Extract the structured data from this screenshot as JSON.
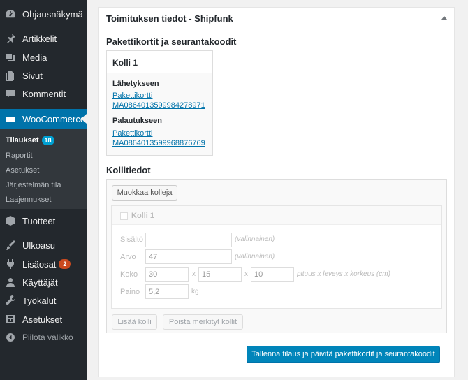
{
  "sidebar": {
    "dashboard": "Ohjausnäkymä",
    "posts": "Artikkelit",
    "media": "Media",
    "pages": "Sivut",
    "comments": "Kommentit",
    "woocommerce": "WooCommerce",
    "submenu": {
      "orders": "Tilaukset",
      "orders_badge": "18",
      "reports": "Raportit",
      "settings": "Asetukset",
      "status": "Järjestelmän tila",
      "extensions": "Laajennukset"
    },
    "products": "Tuotteet",
    "appearance": "Ulkoasu",
    "plugins": "Lisäosat",
    "plugins_badge": "2",
    "users": "Käyttäjät",
    "tools": "Työkalut",
    "settings": "Asetukset",
    "collapse": "Piilota valikko"
  },
  "panel": {
    "title": "Toimituksen tiedot - Shipfunk",
    "labels_title": "Pakettikortit ja seurantakoodit",
    "package": {
      "title": "Kolli 1",
      "outbound_title": "Lähetykseen",
      "outbound_link_line1": "Pakettikortti",
      "outbound_link_line2": "MA0864013599984278971",
      "return_title": "Palautukseen",
      "return_link_line1": "Pakettikortti",
      "return_link_line2": "MA0864013599968876769"
    },
    "parcel_info_title": "Kollitiedot",
    "edit_button": "Muokkaa kolleja",
    "parcel": {
      "title": "Kolli 1",
      "content_label": "Sisältö",
      "content_value": "",
      "content_hint": "(valinnainen)",
      "value_label": "Arvo",
      "value_value": "47",
      "value_hint": "(valinnainen)",
      "size_label": "Koko",
      "width": "30",
      "length": "15",
      "height": "10",
      "x1": "x",
      "x2": "x",
      "size_hint": "pituus x leveys x korkeus (cm)",
      "weight_label": "Paino",
      "weight_value": "5,2",
      "weight_unit": "kg"
    },
    "add_button": "Lisää kolli",
    "remove_button": "Poista merkityt kollit",
    "save_button": "Tallenna tilaus ja päivitä pakettikortit ja seurantakoodit"
  },
  "colors": {
    "sidebar_bg": "#23282d",
    "active": "#0073aa",
    "primary_button": "#0085ba"
  }
}
